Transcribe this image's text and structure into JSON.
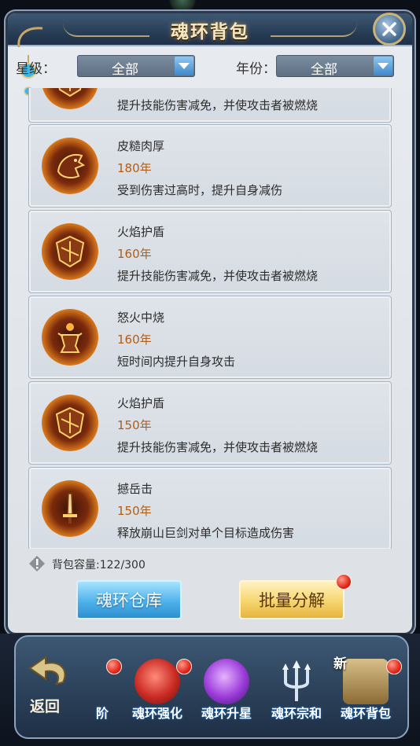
{
  "window": {
    "title": "魂环背包"
  },
  "filters": {
    "star_label": "星级：",
    "star_value": "全部",
    "year_label": "年份：",
    "year_value": "全部"
  },
  "cards": [
    {
      "name": "",
      "year": "",
      "desc": "提升技能伤害减免，并使攻击者被燃烧",
      "icon": "flame-shield-icon"
    },
    {
      "name": "皮糙肉厚",
      "year": "180年",
      "desc": "受到伤害过高时，提升自身减伤",
      "icon": "beast-armor-icon"
    },
    {
      "name": "火焰护盾",
      "year": "160年",
      "desc": "提升技能伤害减免，并使攻击者被燃烧",
      "icon": "flame-shield-icon"
    },
    {
      "name": "怒火中烧",
      "year": "160年",
      "desc": "短时间内提升自身攻击",
      "icon": "rage-figure-icon"
    },
    {
      "name": "火焰护盾",
      "year": "150年",
      "desc": "提升技能伤害减免，并使攻击者被燃烧",
      "icon": "flame-shield-icon"
    },
    {
      "name": "撼岳击",
      "year": "150年",
      "desc": "释放崩山巨剑对单个目标造成伤害",
      "icon": "great-sword-icon"
    }
  ],
  "capacity": {
    "text": "背包容量:122/300"
  },
  "buttons": {
    "warehouse": "魂环仓库",
    "batch_decompose": "批量分解"
  },
  "bottom_nav": {
    "back": "返回",
    "tabs": [
      {
        "label": "阶",
        "icon": "advance-icon",
        "badge": true
      },
      {
        "label": "魂环强化",
        "icon": "red-gem-ring-icon",
        "badge": true
      },
      {
        "label": "魂环升星",
        "icon": "purple-gem-ring-icon",
        "badge": false
      },
      {
        "label": "魂环宗和",
        "icon": "trident-icon",
        "badge": false
      },
      {
        "label": "魂环背包",
        "icon": "treasure-chest-icon",
        "badge": true,
        "new": "新"
      }
    ]
  },
  "colors": {
    "year_text": "#b25d14",
    "accent_blue": "#3f88c9",
    "badge_red": "#e2281c"
  }
}
